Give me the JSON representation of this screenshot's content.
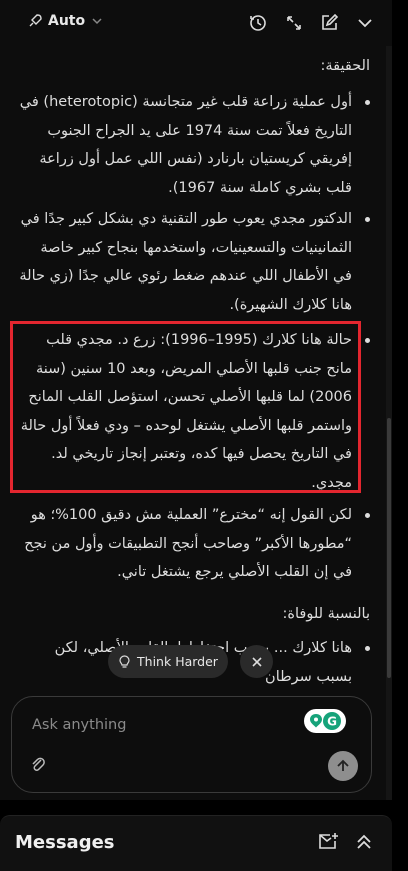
{
  "topbar": {
    "model_label": "Auto",
    "icons": [
      "rocket-icon",
      "chevron-down-icon",
      "history-icon",
      "expand-icon",
      "new-chat-icon",
      "collapse-chevron-icon"
    ]
  },
  "chat": {
    "heading_truth": "الحقيقة:",
    "bullets": [
      "أول عملية زراعة قلب غير متجانسة (heterotopic) في التاريخ فعلاً تمت سنة 1974 على يد الجراح الجنوب إفريقي كريستيان بارنارد (نفس اللي عمل أول زراعة قلب بشري كاملة سنة 1967).",
      "الدكتور مجدي يعوب طور التقنية دي بشكل كبير جدًا في الثمانينيات والتسعينيات، واستخدمها بنجاح كبير خاصة في الأطفال اللي عندهم ضغط رئوي عالي جدًا (زي حالة هانا كلارك الشهيرة).",
      "حالة هانا كلارك (1995–1996): زرع د. مجدي قلب مانح جنب قلبها الأصلي المريض، وبعد 10 سنين (سنة 2006) لما قلبها الأصلي تحسن، استؤصل القلب المانح واستمر قلبها الأصلي يشتغل لوحده – ودي فعلاً أول حالة في التاريخ يحصل فيها كده، وتعتبر إنجاز تاريخي لد. مجدي.",
      "لكن القول إنه “مخترع” العملية مش دقيق 100%؛ هو “مطورها الأكبر” وصاحب أنجح التطبيقات وأول من نجح في إن القلب الأصلي يرجع يشتغل تاني."
    ],
    "heading_death": "بالنسبة للوفاة:",
    "partial_bullet": "هانا كلارك ... بسبب احتفاظها بالقلب الأصلي، لكن بسبب سرطان"
  },
  "floating": {
    "think_harder_label": "Think Harder"
  },
  "composer": {
    "placeholder": "Ask anything"
  },
  "bottom_bar": {
    "title": "Messages"
  },
  "colors": {
    "highlight_border": "#e3262f",
    "background": "#0d0d0d"
  }
}
